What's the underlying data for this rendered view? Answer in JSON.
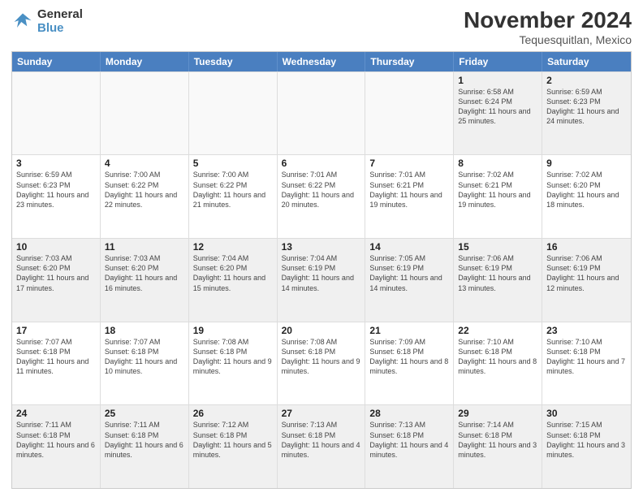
{
  "logo": {
    "line1": "General",
    "line2": "Blue"
  },
  "title": "November 2024",
  "subtitle": "Tequesquitlan, Mexico",
  "days": [
    "Sunday",
    "Monday",
    "Tuesday",
    "Wednesday",
    "Thursday",
    "Friday",
    "Saturday"
  ],
  "rows": [
    [
      {
        "day": "",
        "info": ""
      },
      {
        "day": "",
        "info": ""
      },
      {
        "day": "",
        "info": ""
      },
      {
        "day": "",
        "info": ""
      },
      {
        "day": "",
        "info": ""
      },
      {
        "day": "1",
        "info": "Sunrise: 6:58 AM\nSunset: 6:24 PM\nDaylight: 11 hours and 25 minutes."
      },
      {
        "day": "2",
        "info": "Sunrise: 6:59 AM\nSunset: 6:23 PM\nDaylight: 11 hours and 24 minutes."
      }
    ],
    [
      {
        "day": "3",
        "info": "Sunrise: 6:59 AM\nSunset: 6:23 PM\nDaylight: 11 hours and 23 minutes."
      },
      {
        "day": "4",
        "info": "Sunrise: 7:00 AM\nSunset: 6:22 PM\nDaylight: 11 hours and 22 minutes."
      },
      {
        "day": "5",
        "info": "Sunrise: 7:00 AM\nSunset: 6:22 PM\nDaylight: 11 hours and 21 minutes."
      },
      {
        "day": "6",
        "info": "Sunrise: 7:01 AM\nSunset: 6:22 PM\nDaylight: 11 hours and 20 minutes."
      },
      {
        "day": "7",
        "info": "Sunrise: 7:01 AM\nSunset: 6:21 PM\nDaylight: 11 hours and 19 minutes."
      },
      {
        "day": "8",
        "info": "Sunrise: 7:02 AM\nSunset: 6:21 PM\nDaylight: 11 hours and 19 minutes."
      },
      {
        "day": "9",
        "info": "Sunrise: 7:02 AM\nSunset: 6:20 PM\nDaylight: 11 hours and 18 minutes."
      }
    ],
    [
      {
        "day": "10",
        "info": "Sunrise: 7:03 AM\nSunset: 6:20 PM\nDaylight: 11 hours and 17 minutes."
      },
      {
        "day": "11",
        "info": "Sunrise: 7:03 AM\nSunset: 6:20 PM\nDaylight: 11 hours and 16 minutes."
      },
      {
        "day": "12",
        "info": "Sunrise: 7:04 AM\nSunset: 6:20 PM\nDaylight: 11 hours and 15 minutes."
      },
      {
        "day": "13",
        "info": "Sunrise: 7:04 AM\nSunset: 6:19 PM\nDaylight: 11 hours and 14 minutes."
      },
      {
        "day": "14",
        "info": "Sunrise: 7:05 AM\nSunset: 6:19 PM\nDaylight: 11 hours and 14 minutes."
      },
      {
        "day": "15",
        "info": "Sunrise: 7:06 AM\nSunset: 6:19 PM\nDaylight: 11 hours and 13 minutes."
      },
      {
        "day": "16",
        "info": "Sunrise: 7:06 AM\nSunset: 6:19 PM\nDaylight: 11 hours and 12 minutes."
      }
    ],
    [
      {
        "day": "17",
        "info": "Sunrise: 7:07 AM\nSunset: 6:18 PM\nDaylight: 11 hours and 11 minutes."
      },
      {
        "day": "18",
        "info": "Sunrise: 7:07 AM\nSunset: 6:18 PM\nDaylight: 11 hours and 10 minutes."
      },
      {
        "day": "19",
        "info": "Sunrise: 7:08 AM\nSunset: 6:18 PM\nDaylight: 11 hours and 9 minutes."
      },
      {
        "day": "20",
        "info": "Sunrise: 7:08 AM\nSunset: 6:18 PM\nDaylight: 11 hours and 9 minutes."
      },
      {
        "day": "21",
        "info": "Sunrise: 7:09 AM\nSunset: 6:18 PM\nDaylight: 11 hours and 8 minutes."
      },
      {
        "day": "22",
        "info": "Sunrise: 7:10 AM\nSunset: 6:18 PM\nDaylight: 11 hours and 8 minutes."
      },
      {
        "day": "23",
        "info": "Sunrise: 7:10 AM\nSunset: 6:18 PM\nDaylight: 11 hours and 7 minutes."
      }
    ],
    [
      {
        "day": "24",
        "info": "Sunrise: 7:11 AM\nSunset: 6:18 PM\nDaylight: 11 hours and 6 minutes."
      },
      {
        "day": "25",
        "info": "Sunrise: 7:11 AM\nSunset: 6:18 PM\nDaylight: 11 hours and 6 minutes."
      },
      {
        "day": "26",
        "info": "Sunrise: 7:12 AM\nSunset: 6:18 PM\nDaylight: 11 hours and 5 minutes."
      },
      {
        "day": "27",
        "info": "Sunrise: 7:13 AM\nSunset: 6:18 PM\nDaylight: 11 hours and 4 minutes."
      },
      {
        "day": "28",
        "info": "Sunrise: 7:13 AM\nSunset: 6:18 PM\nDaylight: 11 hours and 4 minutes."
      },
      {
        "day": "29",
        "info": "Sunrise: 7:14 AM\nSunset: 6:18 PM\nDaylight: 11 hours and 3 minutes."
      },
      {
        "day": "30",
        "info": "Sunrise: 7:15 AM\nSunset: 6:18 PM\nDaylight: 11 hours and 3 minutes."
      }
    ]
  ]
}
